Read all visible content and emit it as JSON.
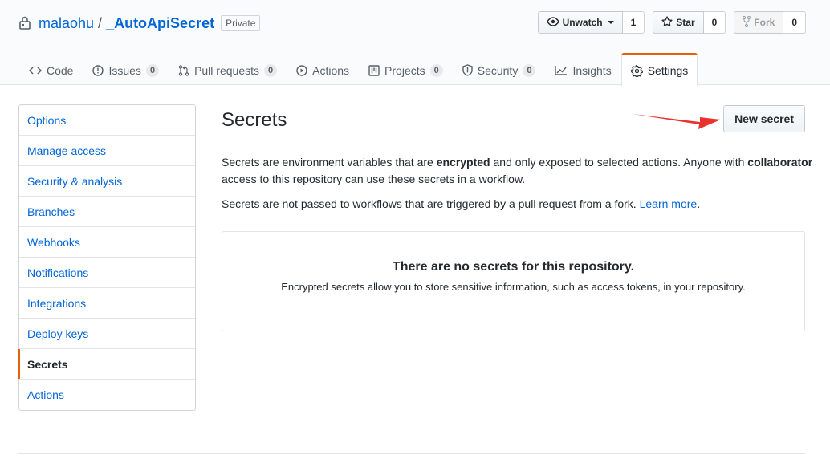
{
  "repo": {
    "owner": "malaohu",
    "separator": "/",
    "name": "_AutoApiSecret",
    "visibility_label": "Private"
  },
  "social": {
    "watch_label": "Unwatch",
    "watch_count": "1",
    "star_label": "Star",
    "star_count": "0",
    "fork_label": "Fork",
    "fork_count": "0"
  },
  "tabs": [
    {
      "label": "Code",
      "icon": "code-icon"
    },
    {
      "label": "Issues",
      "icon": "issue-icon",
      "count": "0"
    },
    {
      "label": "Pull requests",
      "icon": "pull-request-icon",
      "count": "0"
    },
    {
      "label": "Actions",
      "icon": "play-icon"
    },
    {
      "label": "Projects",
      "icon": "project-icon",
      "count": "0"
    },
    {
      "label": "Security",
      "icon": "shield-icon",
      "count": "0"
    },
    {
      "label": "Insights",
      "icon": "graph-icon"
    },
    {
      "label": "Settings",
      "icon": "gear-icon",
      "selected": true
    }
  ],
  "sidebar": {
    "items": [
      {
        "label": "Options"
      },
      {
        "label": "Manage access"
      },
      {
        "label": "Security & analysis"
      },
      {
        "label": "Branches"
      },
      {
        "label": "Webhooks"
      },
      {
        "label": "Notifications"
      },
      {
        "label": "Integrations"
      },
      {
        "label": "Deploy keys"
      },
      {
        "label": "Secrets",
        "selected": true
      },
      {
        "label": "Actions"
      }
    ]
  },
  "main": {
    "title": "Secrets",
    "new_button": "New secret",
    "desc1_a": "Secrets are environment variables that are ",
    "desc1_b": "encrypted",
    "desc1_c": " and only exposed to selected actions. Anyone with ",
    "desc1_d": "collaborator",
    "desc1_e": " access to this repository can use these secrets in a workflow.",
    "desc2_a": "Secrets are not passed to workflows that are triggered by a pull request from a fork. ",
    "desc2_link": "Learn more",
    "desc2_end": ".",
    "empty_title": "There are no secrets for this repository.",
    "empty_desc": "Encrypted secrets allow you to store sensitive information, such as access tokens, in your repository."
  },
  "colors": {
    "link": "#0366d6",
    "selected_accent": "#e36209",
    "annotation_arrow": "#e8322d"
  }
}
